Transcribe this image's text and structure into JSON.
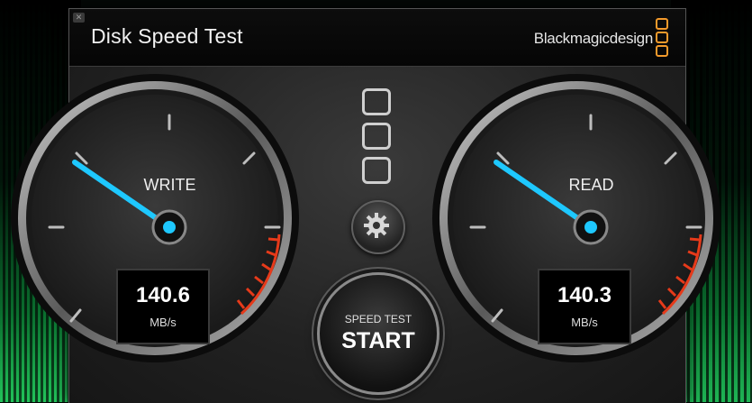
{
  "app": {
    "title": "Disk Speed Test",
    "brand": "Blackmagicdesign"
  },
  "window": {
    "close_label": "✕"
  },
  "gauges": {
    "write": {
      "label": "WRITE",
      "value": "140.6",
      "unit": "MB/s"
    },
    "read": {
      "label": "READ",
      "value": "140.3",
      "unit": "MB/s"
    }
  },
  "start_button": {
    "small_label": "SPEED TEST",
    "big_label": "START"
  },
  "icons": {
    "settings": "gear-icon",
    "logo": "blackmagic-logo-icon",
    "disk": "disk-stack-icon"
  },
  "colors": {
    "needle": "#1ec8ff",
    "redline": "#e63a1a",
    "brand_orange": "#f39a2b"
  }
}
